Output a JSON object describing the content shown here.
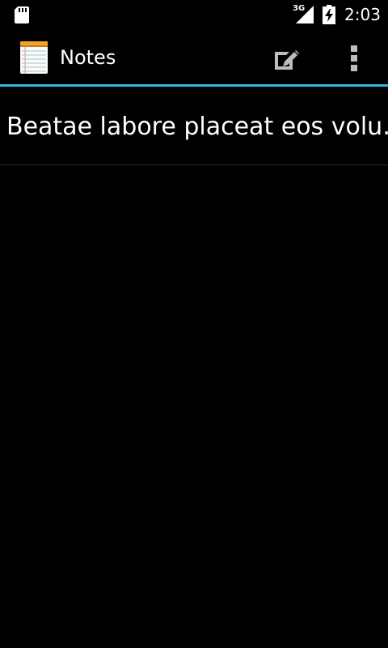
{
  "status_bar": {
    "network_type": "3G",
    "time": "2:03",
    "icons": [
      "sd-card-icon",
      "signal-icon",
      "battery-charging-icon"
    ]
  },
  "action_bar": {
    "title": "Notes",
    "app_icon": "notepad-icon",
    "actions": [
      {
        "name": "new-note",
        "icon": "edit-icon"
      },
      {
        "name": "overflow-menu",
        "icon": "overflow-icon"
      }
    ],
    "accent_color": "#33b5e5"
  },
  "notes": [
    {
      "title": "Beatae labore placeat eos volu…"
    }
  ]
}
